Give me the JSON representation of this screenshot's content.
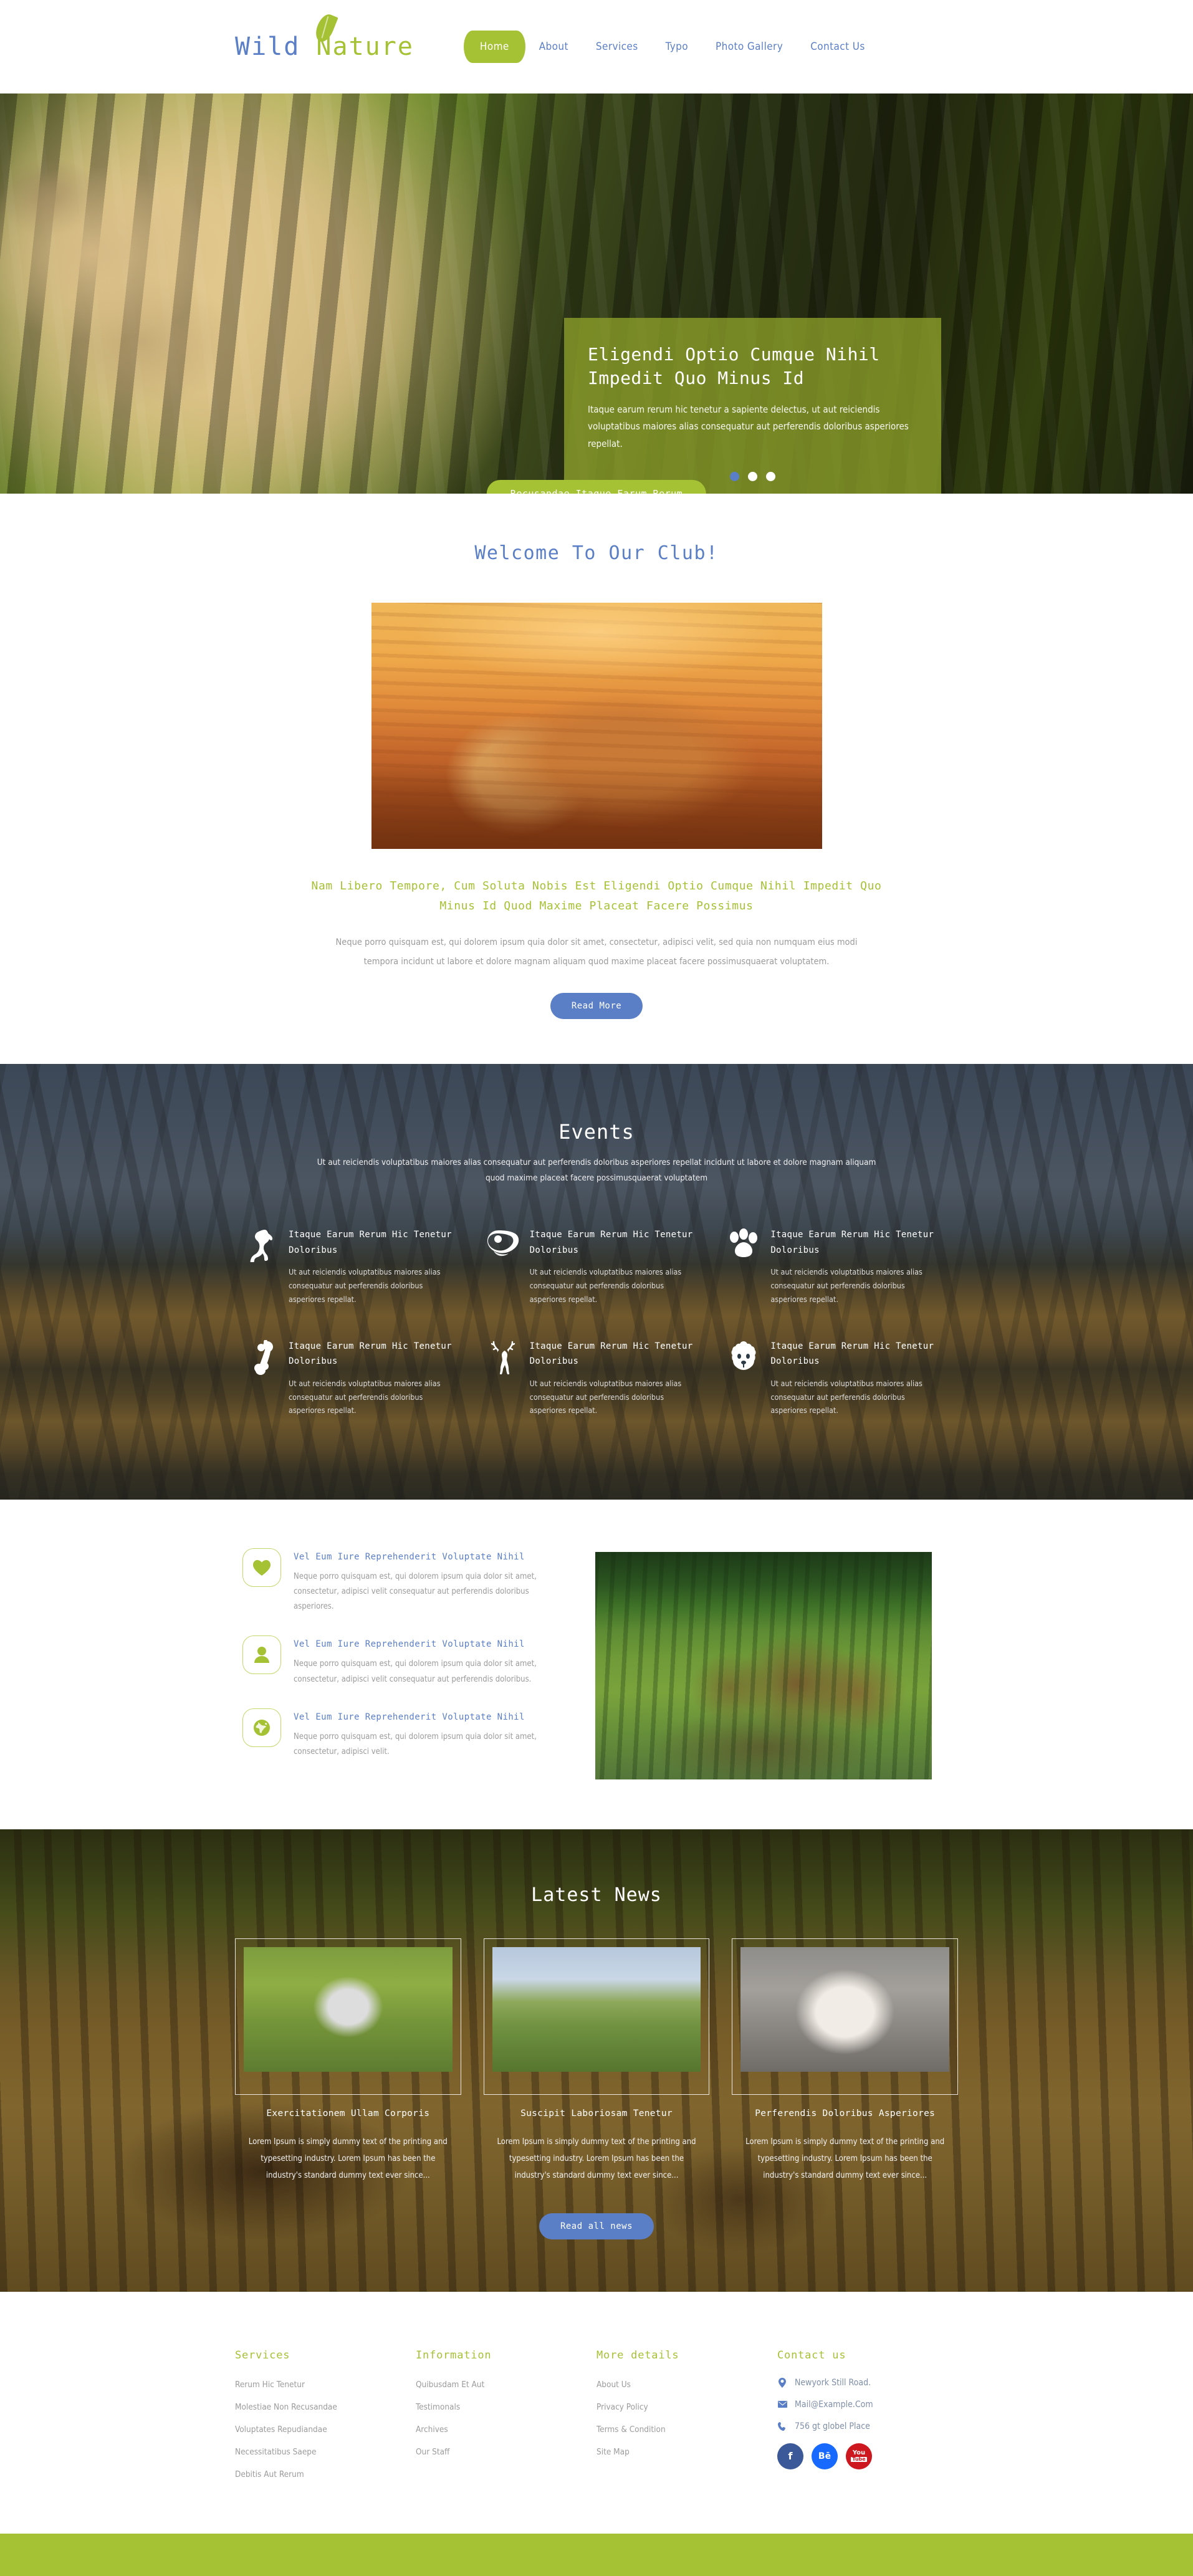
{
  "header": {
    "logo_word1": "Wild",
    "logo_word2": "Nature",
    "nav": [
      {
        "label": "Home",
        "active": true
      },
      {
        "label": "About",
        "active": false
      },
      {
        "label": "Services",
        "active": false
      },
      {
        "label": "Typo",
        "active": false
      },
      {
        "label": "Photo Gallery",
        "active": false
      },
      {
        "label": "Contact Us",
        "active": false
      }
    ]
  },
  "hero": {
    "title": "Eligendi Optio Cumque Nihil Impedit Quo Minus Id",
    "text": "Itaque earum rerum hic tenetur a sapiente delectus, ut aut reiciendis voluptatibus maiores alias consequatur aut perferendis doloribus asperiores repellat.",
    "dots_total": 3,
    "dots_active_index": 0,
    "badge": "Recusandae Itaque Earum Rerum",
    "overlay_color": "#8da02a"
  },
  "welcome": {
    "heading": "Welcome To Our Club!",
    "subheading": "Nam Libero Tempore, Cum Soluta Nobis Est Eligendi Optio Cumque Nihil Impedit Quo Minus Id Quod Maxime Placeat Facere Possimus",
    "paragraph": "Neque porro quisquam est, qui dolorem ipsum quia dolor sit amet, consectetur, adipisci velit, sed quia non numquam eius modi tempora incidunt ut labore et dolore magnam aliquam quod maxime placeat facere possimusquaerat voluptatem.",
    "button": "Read More",
    "image_alt": "lions-photo"
  },
  "events": {
    "heading": "Events",
    "subheading": "Ut aut reiciendis voluptatibus maiores alias consequatur aut perferendis doloribus asperiores repellat incidunt ut labore et dolore magnam aliquam quod maxime placeat facere possimusquaerat voluptatem",
    "items": [
      {
        "icon": "horse-icon",
        "title": "Itaque Earum Rerum Hic Tenetur Doloribus",
        "text": "Ut aut reiciendis voluptatibus maiores alias consequatur aut perferendis doloribus asperiores repellat."
      },
      {
        "icon": "steak-icon",
        "title": "Itaque Earum Rerum Hic Tenetur Doloribus",
        "text": "Ut aut reiciendis voluptatibus maiores alias consequatur aut perferendis doloribus asperiores repellat."
      },
      {
        "icon": "paw-icon",
        "title": "Itaque Earum Rerum Hic Tenetur Doloribus",
        "text": "Ut aut reiciendis voluptatibus maiores alias consequatur aut perferendis doloribus asperiores repellat."
      },
      {
        "icon": "bone-icon",
        "title": "Itaque Earum Rerum Hic Tenetur Doloribus",
        "text": "Ut aut reiciendis voluptatibus maiores alias consequatur aut perferendis doloribus asperiores repellat."
      },
      {
        "icon": "deer-icon",
        "title": "Itaque Earum Rerum Hic Tenetur Doloribus",
        "text": "Ut aut reiciendis voluptatibus maiores alias consequatur aut perferendis doloribus asperiores repellat."
      },
      {
        "icon": "lion-face-icon",
        "title": "Itaque Earum Rerum Hic Tenetur Doloribus",
        "text": "Ut aut reiciendis voluptatibus maiores alias consequatur aut perferendis doloribus asperiores repellat."
      }
    ]
  },
  "features": {
    "items": [
      {
        "icon": "heart-icon",
        "title": "Vel Eum Iure Reprehenderit Voluptate Nihil",
        "text": "Neque porro quisquam est, qui dolorem ipsum quia dolor sit amet, consectetur, adipisci velit consequatur aut perferendis doloribus asperiores."
      },
      {
        "icon": "user-icon",
        "title": "Vel Eum Iure Reprehenderit Voluptate Nihil",
        "text": "Neque porro quisquam est, qui dolorem ipsum quia dolor sit amet, consectetur, adipisci velit consequatur aut perferendis doloribus."
      },
      {
        "icon": "globe-icon",
        "title": "Vel Eum Iure Reprehenderit Voluptate Nihil",
        "text": "Neque porro quisquam est, qui dolorem ipsum quia dolor sit amet, consectetur, adipisci velit."
      }
    ],
    "image_alt": "deer-herd-photo"
  },
  "news": {
    "heading": "Latest News",
    "button": "Read all news",
    "cards": [
      {
        "title": "Exercitationem Ullam Corporis",
        "text": "Lorem Ipsum is simply dummy text of the printing and typesetting industry. Lorem Ipsum has been the industry's standard dummy text ever since...",
        "image_alt": "crane-bird-photo"
      },
      {
        "title": "Suscipit Laboriosam Tenetur",
        "text": "Lorem Ipsum is simply dummy text of the printing and typesetting industry. Lorem Ipsum has been the industry's standard dummy text ever since...",
        "image_alt": "deer-meadow-photo"
      },
      {
        "title": "Perferendis Doloribus Asperiores",
        "text": "Lorem Ipsum is simply dummy text of the printing and typesetting industry. Lorem Ipsum has been the industry's standard dummy text ever since...",
        "image_alt": "papillon-dog-photo"
      }
    ]
  },
  "footer": {
    "columns": [
      {
        "title": "Services",
        "links": [
          "Rerum Hic Tenetur",
          "Molestiae Non Recusandae",
          "Voluptates Repudiandae",
          "Necessitatibus Saepe",
          "Debitis Aut Rerum"
        ]
      },
      {
        "title": "Information",
        "links": [
          "Quibusdam Et Aut",
          "Testimonals",
          "Archives",
          "Our Staff"
        ]
      },
      {
        "title": "More details",
        "links": [
          "About Us",
          "Privacy Policy",
          "Terms & Condition",
          "Site Map"
        ]
      }
    ],
    "contact": {
      "title": "Contact us",
      "address": "Newyork Still Road.",
      "email": "Mail@Example.Com",
      "phone": "756 gt globel Place",
      "socials": [
        {
          "name": "facebook",
          "label": "f"
        },
        {
          "name": "behance",
          "label": "Bē"
        },
        {
          "name": "youtube",
          "label": "You"
        }
      ]
    }
  },
  "colors": {
    "green": "#a5c234",
    "blue": "#5b7fc7",
    "grey_text": "#9b9b9b"
  }
}
